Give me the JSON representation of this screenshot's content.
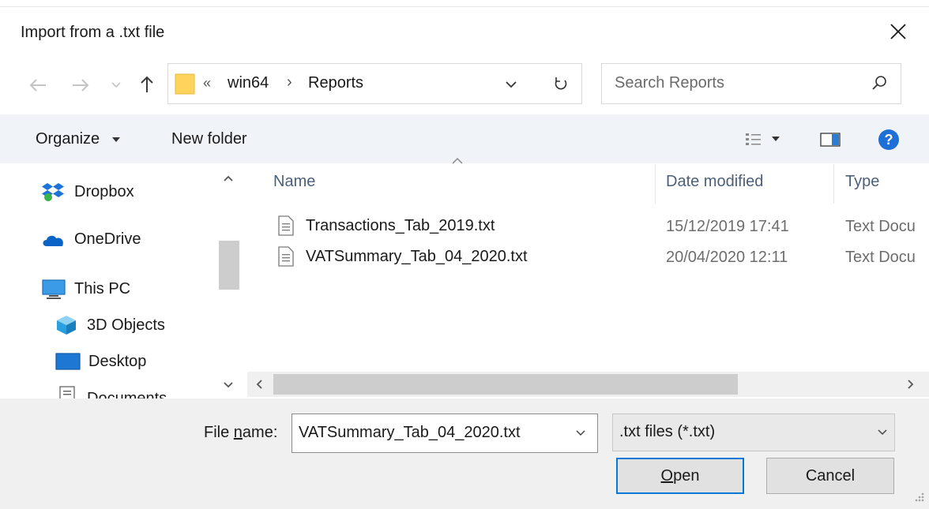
{
  "window": {
    "title": "Import from a .txt file"
  },
  "address": {
    "overflow": "«",
    "crumbs": [
      "win64",
      "Reports"
    ],
    "separator": "›"
  },
  "search": {
    "placeholder": "Search Reports"
  },
  "toolbar": {
    "organize": "Organize",
    "new_folder": "New folder"
  },
  "nav_pane": {
    "items": [
      {
        "label": "Dropbox",
        "icon": "dropbox-icon"
      },
      {
        "label": "OneDrive",
        "icon": "onedrive-icon"
      },
      {
        "label": "This PC",
        "icon": "pc-icon"
      },
      {
        "label": "3D Objects",
        "icon": "3d-objects-icon"
      },
      {
        "label": "Desktop",
        "icon": "desktop-icon"
      },
      {
        "label": "Documents",
        "icon": "documents-icon"
      }
    ]
  },
  "file_list": {
    "columns": [
      "Name",
      "Date modified",
      "Type"
    ],
    "rows": [
      {
        "name": "Transactions_Tab_2019.txt",
        "date": "15/12/2019 17:41",
        "type": "Text Docu"
      },
      {
        "name": "VATSummary_Tab_04_2020.txt",
        "date": "20/04/2020 12:11",
        "type": "Text Docu"
      }
    ]
  },
  "footer": {
    "file_name_label_pre": "File ",
    "file_name_label_ul": "n",
    "file_name_label_post": "ame:",
    "file_name_value": "VATSummary_Tab_04_2020.txt",
    "file_type": ".txt files (*.txt)",
    "open_ul": "O",
    "open_rest": "pen",
    "cancel": "Cancel"
  },
  "colors": {
    "accent": "#0078d7",
    "folder": "#ffd35c",
    "help": "#1e6fd6"
  }
}
